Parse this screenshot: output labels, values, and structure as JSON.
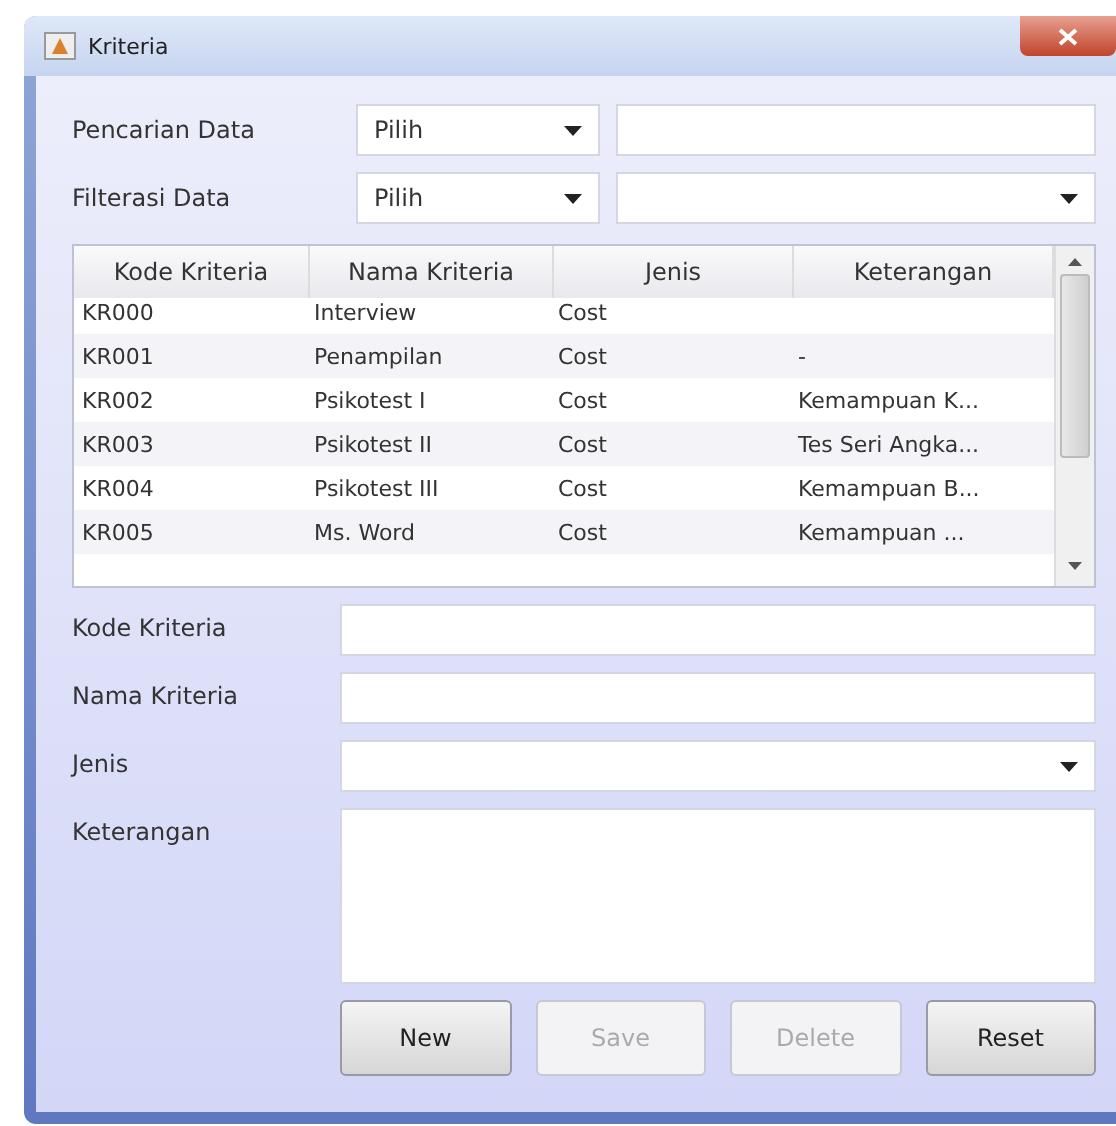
{
  "window": {
    "title": "Kriteria"
  },
  "search": {
    "label": "Pencarian Data",
    "combo": "Pilih"
  },
  "filter": {
    "label": "Filterasi Data",
    "combo": "Pilih"
  },
  "table": {
    "columns": [
      "Kode Kriteria",
      "Nama Kriteria",
      "Jenis",
      "Keterangan"
    ],
    "rows": [
      [
        "KR000",
        "Interview",
        "Cost",
        ""
      ],
      [
        "KR001",
        "Penampilan",
        "Cost",
        "-"
      ],
      [
        "KR002",
        "Psikotest I",
        "Cost",
        "Kemampuan K..."
      ],
      [
        "KR003",
        "Psikotest II",
        "Cost",
        "Tes Seri Angka..."
      ],
      [
        "KR004",
        "Psikotest III",
        "Cost",
        "Kemampuan B..."
      ],
      [
        "KR005",
        "Ms. Word",
        "Cost",
        "Kemampuan ..."
      ]
    ]
  },
  "form": [
    {
      "label": "Kode Kriteria",
      "kind": "text"
    },
    {
      "label": "Nama Kriteria",
      "kind": "text"
    },
    {
      "label": "Jenis",
      "kind": "combo"
    },
    {
      "label": "Keterangan",
      "kind": "area"
    }
  ],
  "buttons": [
    {
      "label": "New",
      "disabled": false
    },
    {
      "label": "Save",
      "disabled": true
    },
    {
      "label": "Delete",
      "disabled": true
    },
    {
      "label": "Reset",
      "disabled": false
    }
  ]
}
